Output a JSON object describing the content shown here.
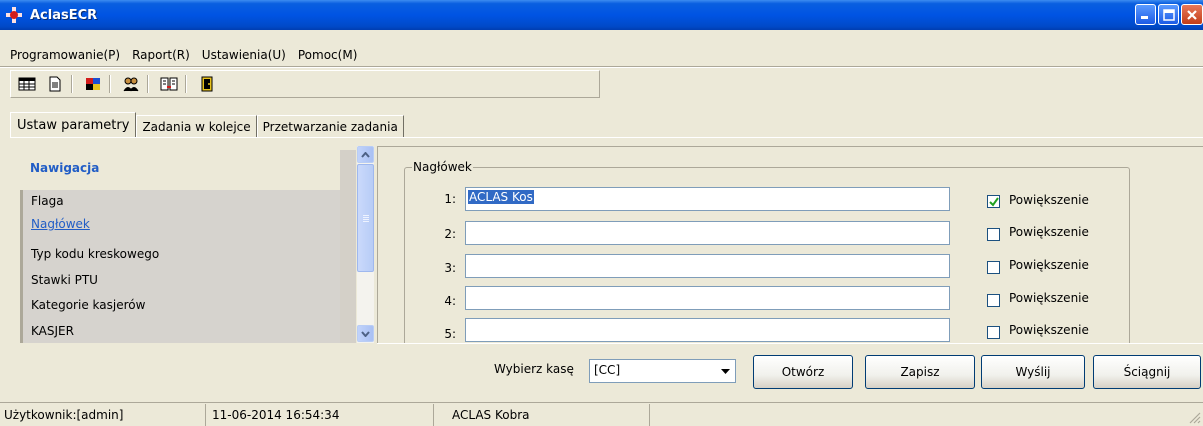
{
  "window": {
    "title": "AclasECR"
  },
  "menu": [
    {
      "label": "Programowanie(P)"
    },
    {
      "label": "Raport(R)"
    },
    {
      "label": "Ustawienia(U)"
    },
    {
      "label": "Pomoc(M)"
    }
  ],
  "toolbar": {
    "icons": [
      "table-icon",
      "document-icon",
      "colored-cube-icon",
      "users-icon",
      "transfer-icon",
      "exit-door-icon"
    ]
  },
  "tabs": [
    {
      "label": "Ustaw parametry",
      "active": true
    },
    {
      "label": "Zadania w kolejce",
      "active": false
    },
    {
      "label": "Przetwarzanie zadania",
      "active": false
    }
  ],
  "navigation": {
    "title": "Nawigacja",
    "items": [
      {
        "label": "Flaga",
        "selected": false
      },
      {
        "label": "Nagłówek",
        "selected": true
      },
      {
        "label": "Typ kodu kreskowego",
        "selected": false
      },
      {
        "label": "Stawki PTU",
        "selected": false
      },
      {
        "label": "Kategorie kasjerów",
        "selected": false
      },
      {
        "label": "KASJER",
        "selected": false
      }
    ]
  },
  "header_group": {
    "legend": "Nagłówek",
    "rows": [
      {
        "num": "1:",
        "value": "ACLAS Kos",
        "checkbox_label": "Powiększenie",
        "checked": true
      },
      {
        "num": "2:",
        "value": "",
        "checkbox_label": "Powiększenie",
        "checked": false
      },
      {
        "num": "3:",
        "value": "",
        "checkbox_label": "Powiększenie",
        "checked": false
      },
      {
        "num": "4:",
        "value": "",
        "checkbox_label": "Powiększenie",
        "checked": false
      },
      {
        "num": "5:",
        "value": "",
        "checkbox_label": "Powiększenie",
        "checked": false
      }
    ]
  },
  "bottom": {
    "select_label": "Wybierz kasę",
    "select_value": "[CC]",
    "buttons": {
      "open": "Otwórz",
      "save": "Zapisz",
      "send": "Wyślij",
      "download": "Ściągnij"
    }
  },
  "status": {
    "user": "Użytkownik:[admin]",
    "datetime": "11-06-2014 16:54:34",
    "device": "ACLAS Kobra"
  },
  "colors": {
    "titlebar": "#0054e3",
    "link": "#215dc6",
    "selection": "#316ac5"
  }
}
